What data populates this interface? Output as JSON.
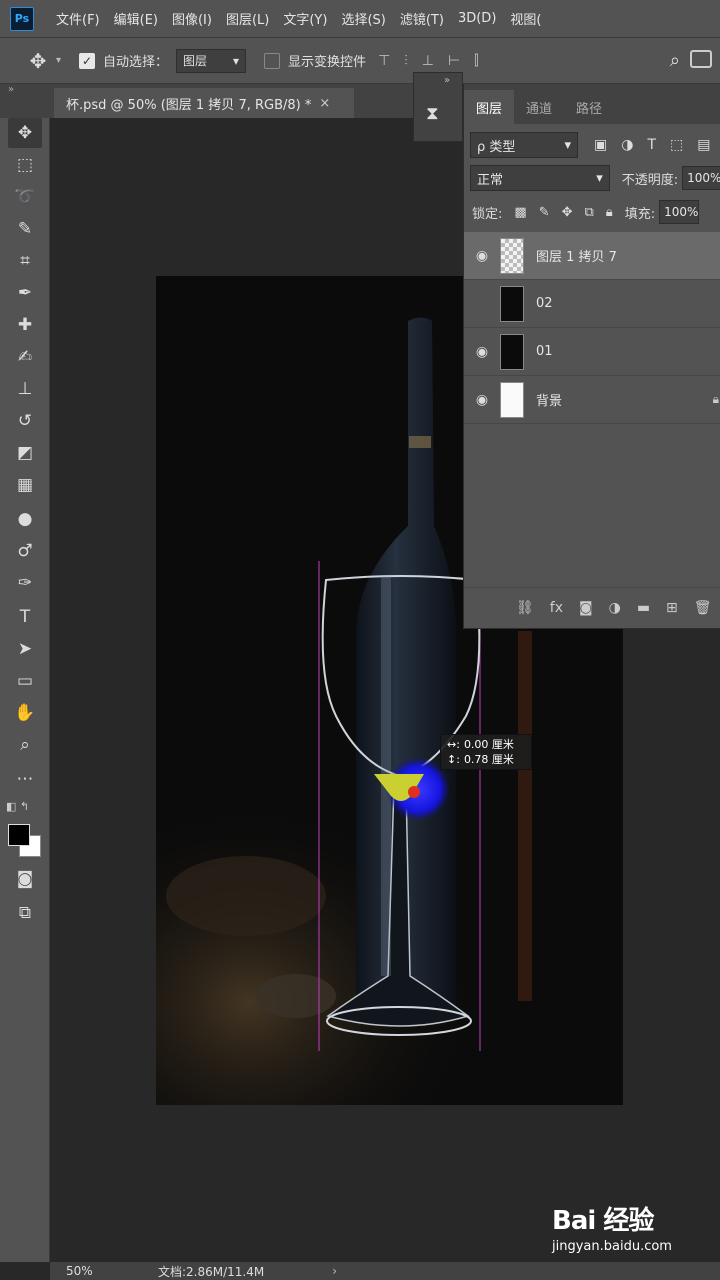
{
  "app": {
    "logo_text": "Ps"
  },
  "menubar": {
    "items": [
      "文件(F)",
      "编辑(E)",
      "图像(I)",
      "图层(L)",
      "文字(Y)",
      "选择(S)",
      "滤镜(T)",
      "3D(D)",
      "视图("
    ]
  },
  "options": {
    "auto_select_label": "自动选择：",
    "auto_select_value": "图层",
    "show_transform_label": "显示变换控件",
    "auto_select_checked": true,
    "show_transform_checked": false
  },
  "document": {
    "tab_title": "杯.psd @ 50% (图层 1 拷贝 7, RGB/8) *",
    "close_glyph": "×"
  },
  "status": {
    "zoom": "50%",
    "doc_size": "文档:2.86M/11.4M",
    "arrow": "›"
  },
  "layers_panel": {
    "tabs": [
      "图层",
      "通道",
      "路径"
    ],
    "filter_label": "ρ 类型",
    "blend_mode": "正常",
    "opacity_label": "不透明度:",
    "opacity_value": "100%",
    "lock_label": "锁定:",
    "fill_label": "填充:",
    "fill_value": "100%",
    "layers": [
      {
        "name": "图层 1 拷贝 7",
        "visible": true,
        "selected": true,
        "thumb": "checker"
      },
      {
        "name": "02",
        "visible": false,
        "selected": false,
        "thumb": "dark"
      },
      {
        "name": "01",
        "visible": true,
        "selected": false,
        "thumb": "dark"
      },
      {
        "name": "背景",
        "visible": true,
        "selected": false,
        "thumb": "white"
      }
    ],
    "footer_icons": [
      "link-icon",
      "fx-icon",
      "mask-icon",
      "adjustment-icon",
      "folder-icon",
      "new-layer-icon",
      "trash-icon"
    ]
  },
  "measure_tip": {
    "row1_label": "↔:",
    "row1_value": "0.00 厘米",
    "row2_label": "↕:",
    "row2_value": "0.78 厘米"
  },
  "watermark": {
    "brand": "Bai 经验",
    "url": "jingyan.baidu.com"
  },
  "colors": {
    "ui_panel": "#535353",
    "ui_dark": "#424242",
    "canvas_bg": "#282828",
    "foreground": "#000000",
    "background": "#ffffff",
    "guide": "#c040c0"
  }
}
